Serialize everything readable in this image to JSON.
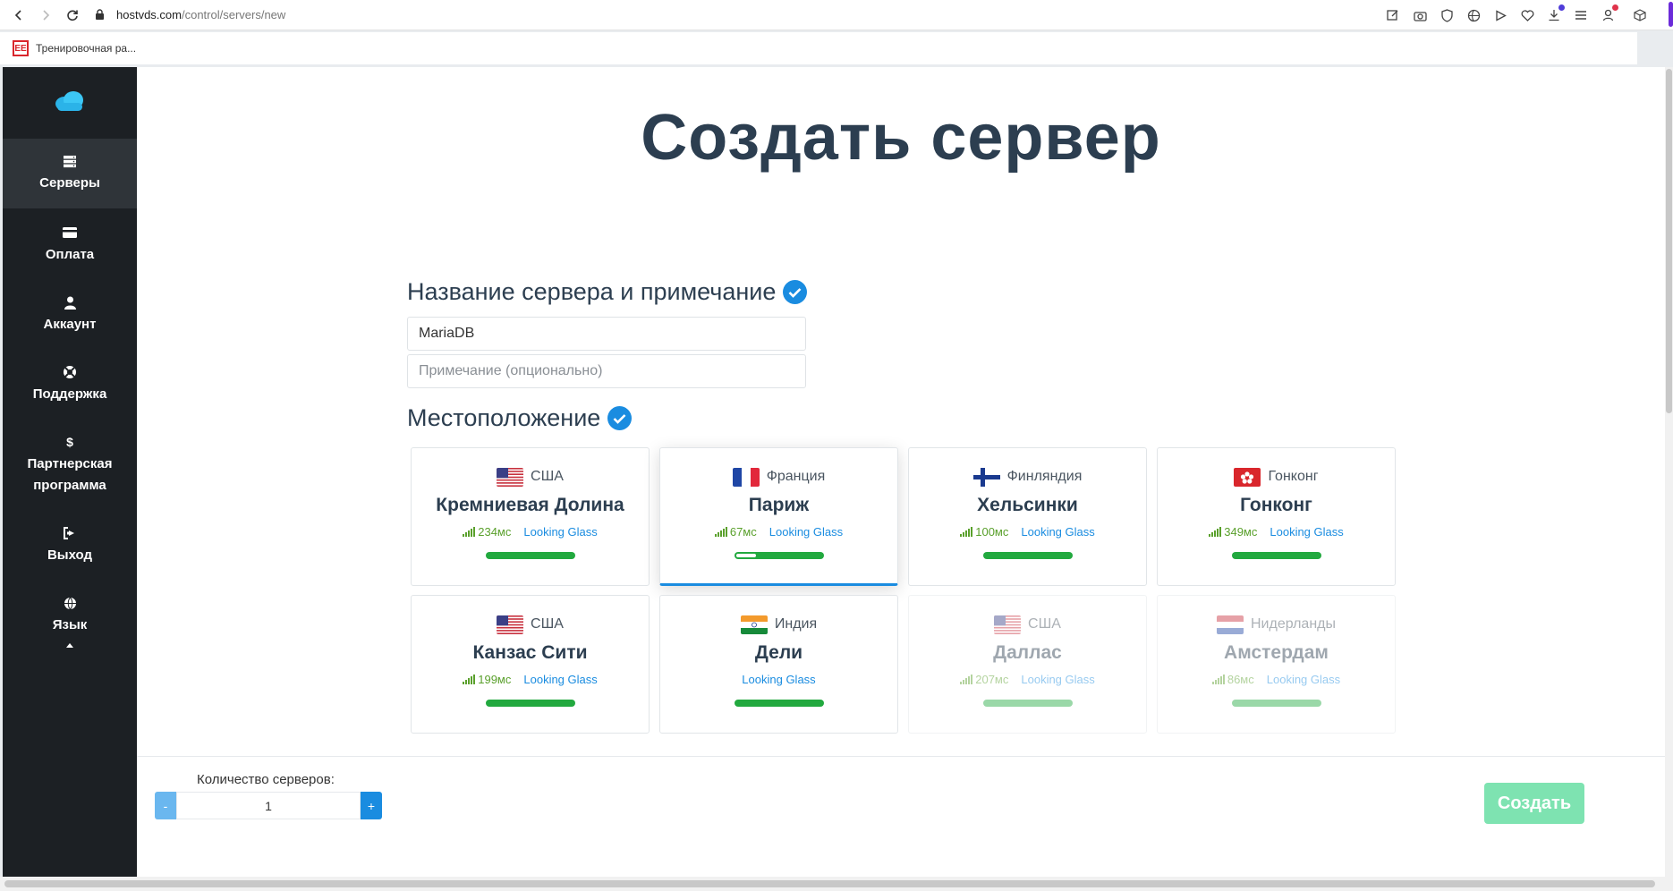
{
  "browser": {
    "url_host": "hostvds.com",
    "url_path": "/control/servers/new",
    "bookmark_label": "Тренировочная ра..."
  },
  "sidebar": {
    "items": [
      {
        "label": "Серверы",
        "icon": "servers-icon"
      },
      {
        "label": "Оплата",
        "icon": "credit-card-icon"
      },
      {
        "label": "Аккаунт",
        "icon": "user-icon"
      },
      {
        "label": "Поддержка",
        "icon": "lifebuoy-icon"
      },
      {
        "label": "Партнерская программа",
        "icon": "dollar-icon"
      },
      {
        "label": "Выход",
        "icon": "sign-out-icon"
      },
      {
        "label": "Язык",
        "icon": "globe-icon"
      }
    ]
  },
  "page": {
    "title": "Создать сервер",
    "name_section": "Название сервера и примечание",
    "name_value": "MariaDB",
    "note_placeholder": "Примечание (опционально)",
    "location_section": "Местоположение"
  },
  "locations": [
    {
      "country": "США",
      "city": "Кремниевая Долина",
      "ping": "234мс",
      "lg": "Looking Glass",
      "flag": "us"
    },
    {
      "country": "Франция",
      "city": "Париж",
      "ping": "67мс",
      "lg": "Looking Glass",
      "flag": "fr"
    },
    {
      "country": "Финляндия",
      "city": "Хельсинки",
      "ping": "100мс",
      "lg": "Looking Glass",
      "flag": "fi"
    },
    {
      "country": "Гонконг",
      "city": "Гонконг",
      "ping": "349мс",
      "lg": "Looking Glass",
      "flag": "hk"
    },
    {
      "country": "США",
      "city": "Канзас Сити",
      "ping": "199мс",
      "lg": "Looking Glass",
      "flag": "us"
    },
    {
      "country": "Индия",
      "city": "Дели",
      "ping": "",
      "lg": "Looking Glass",
      "flag": "in"
    },
    {
      "country": "США",
      "city": "Даллас",
      "ping": "207мс",
      "lg": "Looking Glass",
      "flag": "us"
    },
    {
      "country": "Нидерланды",
      "city": "Амстердам",
      "ping": "86мс",
      "lg": "Looking Glass",
      "flag": "nl"
    }
  ],
  "footer": {
    "qty_label": "Количество серверов:",
    "qty_value": "1",
    "minus": "-",
    "plus": "+",
    "create": "Создать"
  },
  "colors": {
    "sidebar_bg": "#1c2024",
    "accent": "#1a8ce0",
    "create_button": "#7ee3b1",
    "status_bar": "#22a93f"
  }
}
